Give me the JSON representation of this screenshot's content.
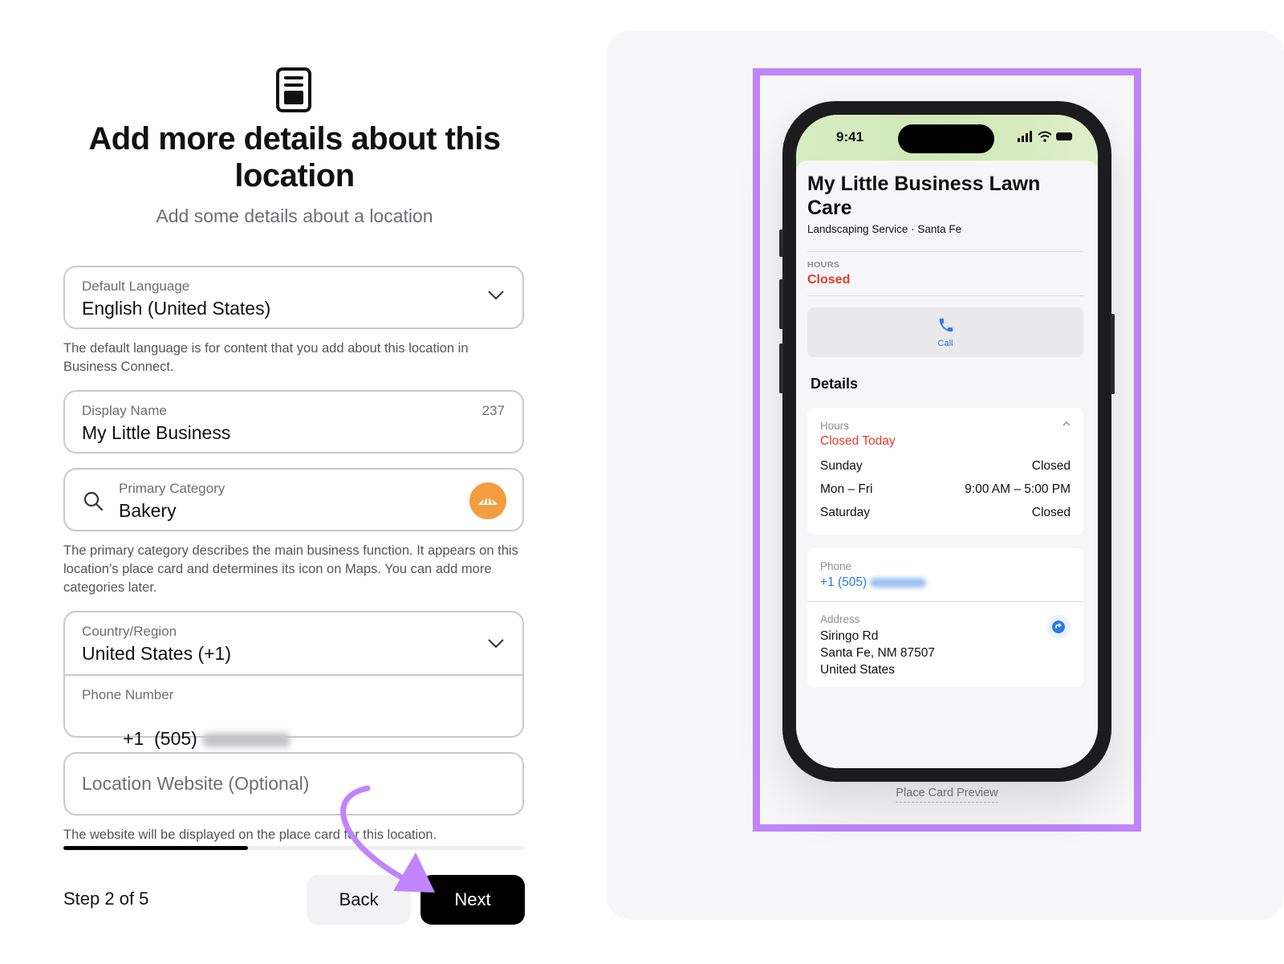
{
  "header": {
    "title": "Add more details about this location",
    "subtitle": "Add some details about a location",
    "icon": "document-icon"
  },
  "form": {
    "language": {
      "label": "Default Language",
      "value": "English (United States)",
      "help": "The default language is for content that you add about this location in Business Connect."
    },
    "display_name": {
      "label": "Display Name",
      "value": "My Little Business",
      "counter": "237"
    },
    "category": {
      "label": "Primary Category",
      "value": "Bakery",
      "help": "The primary category describes the main business function. It appears on this location’s place card and determines its icon on Maps. You can add more categories later.",
      "badge_color": "#f29d3f"
    },
    "country": {
      "label": "Country/Region",
      "value": "United States (+1)"
    },
    "phone": {
      "label": "Phone Number",
      "value": "+1  (505)"
    },
    "website": {
      "placeholder": "Location Website (Optional)",
      "help": "The website will be displayed on the place card for this location."
    }
  },
  "footer": {
    "step": "Step 2 of 5",
    "progress": 0.4,
    "back_label": "Back",
    "next_label": "Next"
  },
  "preview": {
    "time": "9:41",
    "business_name": "My Little Business Lawn Care",
    "subtitle": "Landscaping Service · Santa Fe",
    "hours_label": "HOURS",
    "hours_status": "Closed",
    "call_label": "Call",
    "details_heading": "Details",
    "hours_card": {
      "label": "Hours",
      "status": "Closed Today",
      "rows": [
        {
          "day": "Sunday",
          "time": "Closed"
        },
        {
          "day": "Mon – Fri",
          "time": "9:00 AM – 5:00 PM"
        },
        {
          "day": "Saturday",
          "time": "Closed"
        }
      ]
    },
    "phone_label": "Phone",
    "phone_value": "+1 (505)",
    "address_label": "Address",
    "address_lines": [
      "Siringo Rd",
      "Santa Fe, NM 87507",
      "United States"
    ],
    "caption": "Place Card Preview",
    "highlight_color": "#c084fc",
    "accent_red": "#e03a2f",
    "accent_blue": "#2a7be4"
  }
}
